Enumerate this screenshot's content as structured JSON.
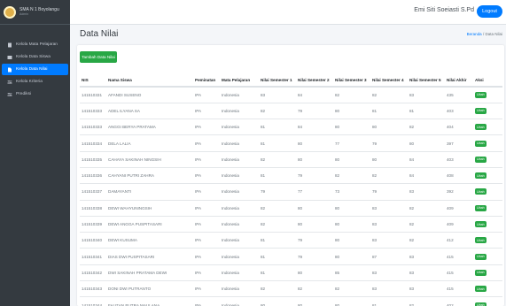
{
  "brand": {
    "title": "SMA N 1 Boyolangu",
    "subtitle": "Admin"
  },
  "sidebar": {
    "items": [
      {
        "label": "Kelola Mata Pelajaran",
        "icon": "book-icon",
        "active": false
      },
      {
        "label": "Kelola Data Siswa",
        "icon": "table-icon",
        "active": false
      },
      {
        "label": "Kelola Data Nilai",
        "icon": "file-icon",
        "active": true
      },
      {
        "label": "Kelola Kriteria",
        "icon": "sliders-icon",
        "active": false
      },
      {
        "label": "Prediksi",
        "icon": "sliders-icon",
        "active": false
      }
    ]
  },
  "header": {
    "user": "Emi Siti Soeiasti S.Pd",
    "logout": "Logout"
  },
  "page": {
    "title": "Data Nilai"
  },
  "breadcrumb": {
    "home": "Beranda",
    "separator": "/",
    "current": "Data Nilai"
  },
  "toolbar": {
    "add_label": "Tambah Data Nilai"
  },
  "table": {
    "headers": [
      "NIS",
      "Nama Siswa",
      "Peminatan",
      "Mata Pelajaran",
      "Nilai Semester 1",
      "Nilai Semester 2",
      "Nilai Semester 3",
      "Nilai Semester 4",
      "Nilai Semester 5",
      "Nilai Akhir",
      "Aksi"
    ],
    "action_label": "Ubah",
    "rows": [
      [
        "141510331",
        "AFANDI SUSENO",
        "IPA",
        "Indonesia",
        "83",
        "84",
        "82",
        "82",
        "83",
        "435",
        "Ubah"
      ],
      [
        "141510333",
        "ADEL ILYANA SA",
        "IPA",
        "Indonesia",
        "82",
        "79",
        "80",
        "81",
        "81",
        "403",
        "Ubah"
      ],
      [
        "141510333",
        "ANGGI BERYA PRATAMA",
        "IPA",
        "Indonesia",
        "81",
        "84",
        "80",
        "80",
        "82",
        "404",
        "Ubah"
      ],
      [
        "141510334",
        "DELA LALIA",
        "IPA",
        "Indonesia",
        "81",
        "80",
        "77",
        "79",
        "80",
        "397",
        "Ubah"
      ],
      [
        "141510335",
        "CAHAYA SAKINAH NINGSIH",
        "IPA",
        "Indonesia",
        "82",
        "80",
        "80",
        "80",
        "84",
        "403",
        "Ubah"
      ],
      [
        "141510336",
        "CAHYANI PUTRI ZAHRA",
        "IPA",
        "Indonesia",
        "81",
        "79",
        "82",
        "82",
        "84",
        "408",
        "Ubah"
      ],
      [
        "141510337",
        "DAMAYANTI",
        "IPA",
        "Indonesia",
        "79",
        "77",
        "73",
        "79",
        "83",
        "392",
        "Ubah"
      ],
      [
        "141510338",
        "DEWI WAHYUNINGSIH",
        "IPA",
        "Indonesia",
        "82",
        "80",
        "80",
        "83",
        "82",
        "409",
        "Ubah"
      ],
      [
        "141510339",
        "DEWI ANGGA PUSPITASARI",
        "IPA",
        "Indonesia",
        "82",
        "80",
        "80",
        "83",
        "82",
        "409",
        "Ubah"
      ],
      [
        "141510340",
        "DEWI KUSUMA",
        "IPA",
        "Indonesia",
        "81",
        "79",
        "80",
        "83",
        "82",
        "412",
        "Ubah"
      ],
      [
        "141510341",
        "DIAS DWI PUSPITASARI",
        "IPA",
        "Indonesia",
        "81",
        "79",
        "80",
        "87",
        "83",
        "415",
        "Ubah"
      ],
      [
        "141510342",
        "DWI SAKINAH PRATAMA DEWI",
        "IPA",
        "Indonesia",
        "81",
        "80",
        "85",
        "83",
        "83",
        "415",
        "Ubah"
      ],
      [
        "141510343",
        "DONI DWI PUTRANTO",
        "IPA",
        "Indonesia",
        "82",
        "82",
        "82",
        "83",
        "83",
        "415",
        "Ubah"
      ],
      [
        "141510344",
        "FAUZAN PUTRA MAULANA",
        "IPA",
        "Indonesia",
        "80",
        "80",
        "80",
        "81",
        "82",
        "402",
        "Ubah"
      ]
    ]
  }
}
